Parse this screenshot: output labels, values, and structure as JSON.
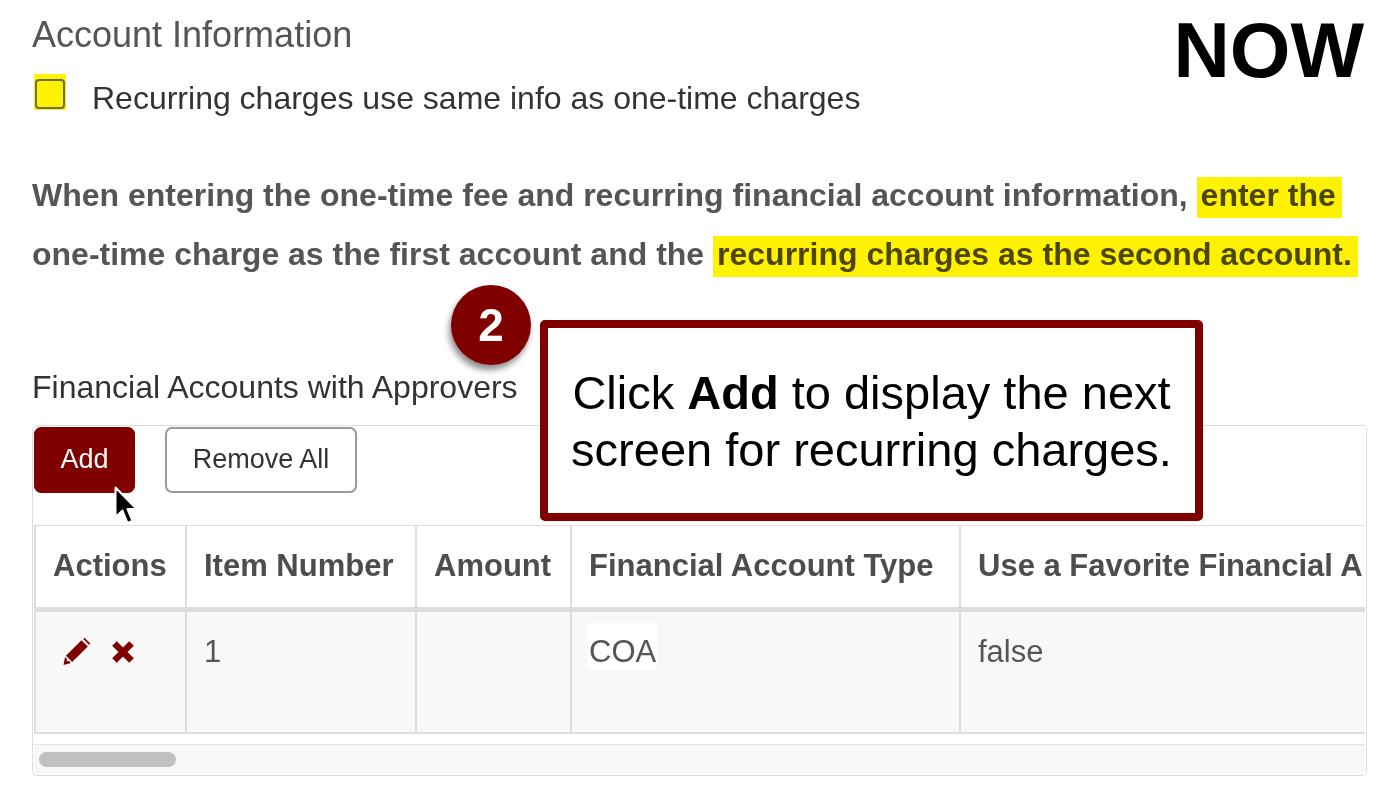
{
  "heading": "Account Information",
  "corner_label": "NOW",
  "same_info_checkbox": {
    "label": "Recurring charges use same info as one-time charges",
    "checked": false,
    "highlighted": true
  },
  "note": {
    "segments": [
      {
        "text": "When entering the one-time fee and recurring financial account information,",
        "highlighted": false
      },
      {
        "text": "enter the",
        "highlighted": true
      },
      {
        "text": "one-time charge as the first account and the",
        "highlighted": false
      },
      {
        "text": "recurring charges as the second account.",
        "highlighted": true
      }
    ]
  },
  "callout": {
    "number": "2",
    "text": "Click **Add** to display the next screen for recurring charges."
  },
  "section_title": "Financial Accounts with Approvers",
  "toolbar": {
    "buttons": [
      {
        "label": "Add",
        "kind": "primary"
      },
      {
        "label": "Remove All",
        "kind": "secondary"
      }
    ]
  },
  "table": {
    "columns": [
      "Actions",
      "Item Number",
      "Amount",
      "Financial Account Type",
      "Use a Favorite Financial A"
    ],
    "rows": [
      {
        "cells": [
          {
            "kind": "actions"
          },
          {
            "kind": "text",
            "text": "1"
          },
          {
            "kind": "empty"
          },
          {
            "kind": "field",
            "text": "COA"
          },
          {
            "kind": "text",
            "text": "false"
          }
        ]
      }
    ]
  }
}
